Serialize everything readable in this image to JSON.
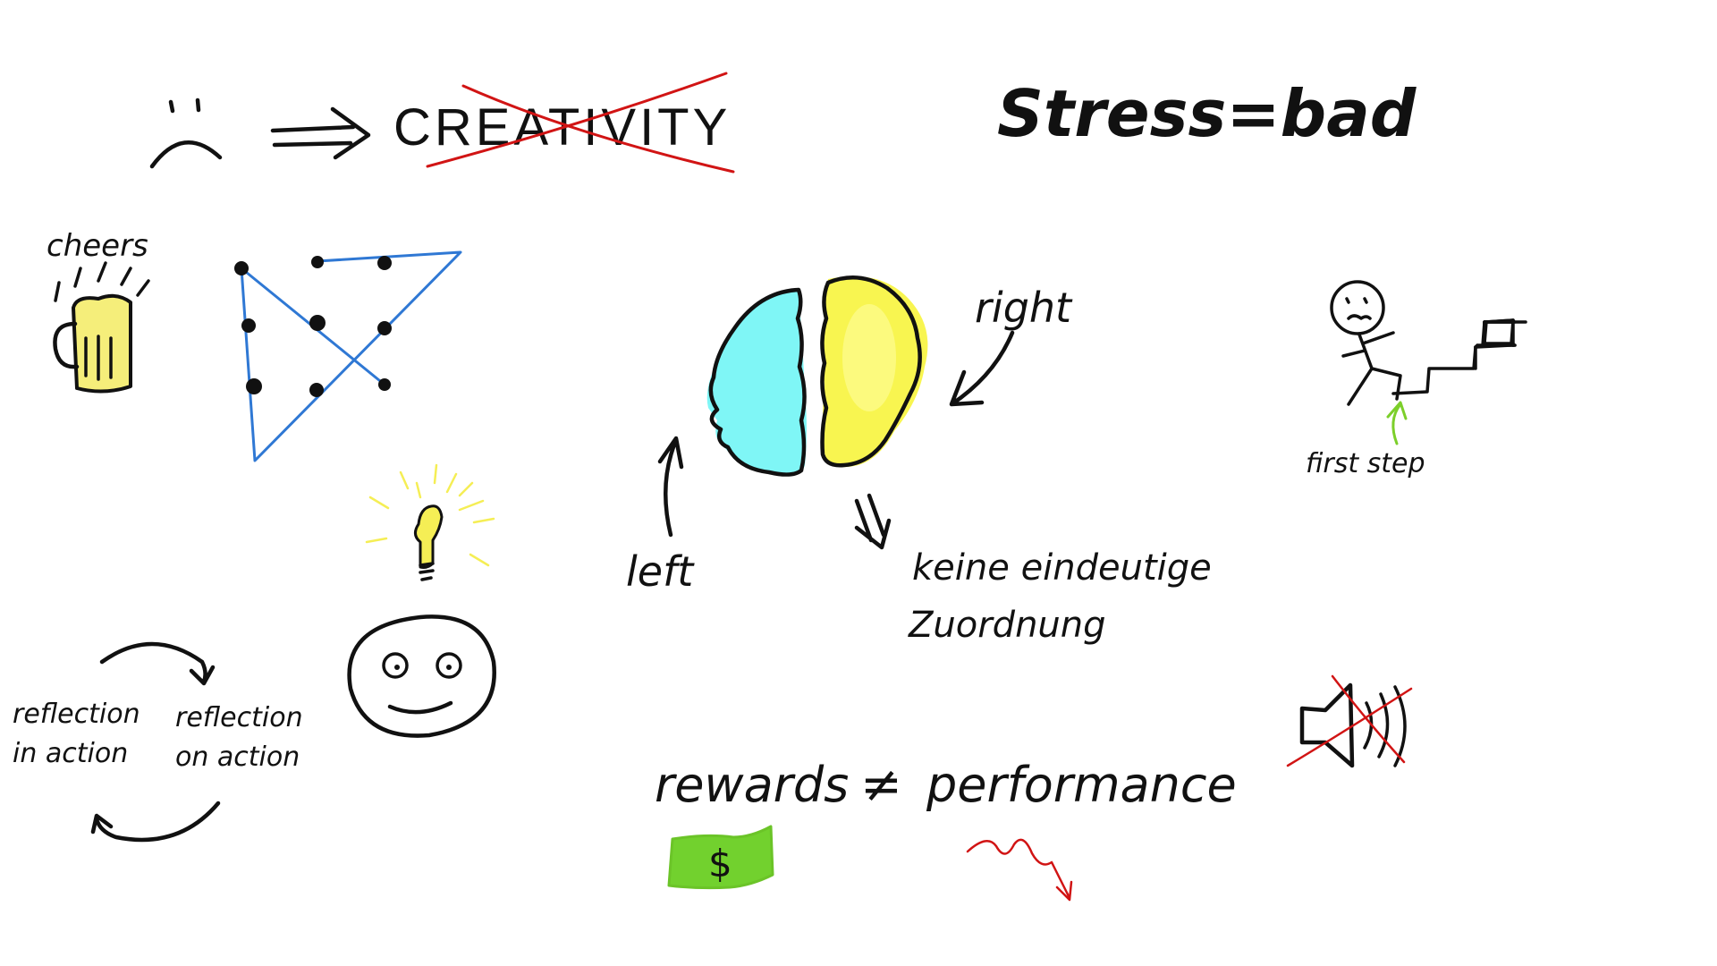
{
  "texts": {
    "creativity": "CREATIVITY",
    "stress": "Stress=bad",
    "cheers": "cheers",
    "right": "right",
    "left": "left",
    "unclear_line1": "keine eindeutige",
    "unclear_line2": "Zuordnung",
    "first_step": "first step",
    "reflection_in_1": "reflection",
    "reflection_in_2": "in action",
    "reflection_on_1": "reflection",
    "reflection_on_2": "on action",
    "rewards": "rewards",
    "not_equal": "≠",
    "performance": "performance",
    "dollar": "$"
  },
  "colors": {
    "ink": "#111111",
    "red": "#d11414",
    "blue": "#2f78d4",
    "cyan": "#7ff6f6",
    "yellow": "#f8f550",
    "green": "#7ccf2a",
    "money": "#72d12e",
    "beer": "#f5ee7a",
    "bulb": "#f5ee55"
  },
  "icons": [
    "sad-face-icon",
    "arrow-implies-icon",
    "beer-mug-icon",
    "nine-dot-puzzle-icon",
    "brain-icon",
    "stick-figure-stairs-icon",
    "light-bulb-icon",
    "happy-face-icon",
    "cycle-arrows-icon",
    "dollar-bill-icon",
    "decline-arrow-icon",
    "muted-speaker-icon"
  ]
}
